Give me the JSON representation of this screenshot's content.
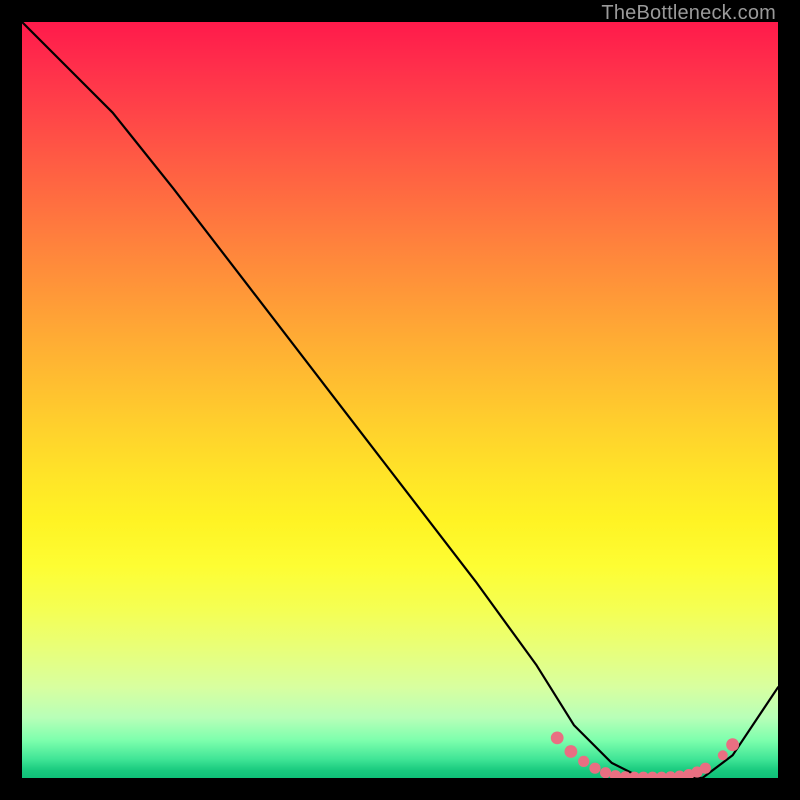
{
  "watermark": "TheBottleneck.com",
  "gradient_colors": {
    "top": "#ff1a4b",
    "mid": "#ffe428",
    "bottom": "#0fbf78"
  },
  "chart_data": {
    "type": "line",
    "title": "",
    "xlabel": "",
    "ylabel": "",
    "xlim": [
      0,
      100
    ],
    "ylim": [
      0,
      100
    ],
    "series": [
      {
        "name": "bottleneck-curve",
        "x": [
          0,
          7,
          12,
          20,
          30,
          40,
          50,
          60,
          68,
          73,
          78,
          82,
          86,
          90,
          94,
          100
        ],
        "y": [
          100,
          93,
          88,
          78,
          65,
          52,
          39,
          26,
          15,
          7,
          2,
          0,
          0,
          0,
          3,
          12
        ]
      }
    ],
    "marker_cluster": {
      "note": "pink dotted segment near valley",
      "points_x": [
        70.8,
        72.6,
        74.3,
        75.8,
        77.2,
        78.5,
        79.8,
        81.0,
        82.2,
        83.4,
        84.6,
        85.8,
        87.0,
        88.2,
        89.3,
        90.4,
        92.7,
        94.0
      ],
      "points_y": [
        5.3,
        3.5,
        2.2,
        1.3,
        0.7,
        0.3,
        0.15,
        0.1,
        0.1,
        0.1,
        0.1,
        0.15,
        0.25,
        0.45,
        0.8,
        1.3,
        3.0,
        4.4
      ]
    }
  }
}
